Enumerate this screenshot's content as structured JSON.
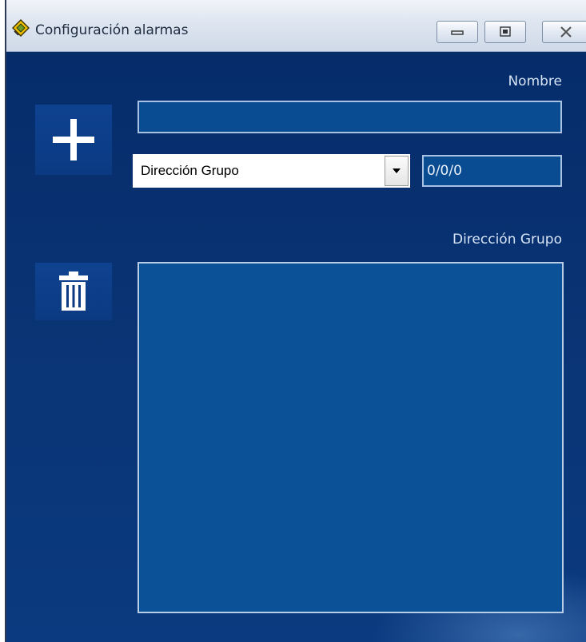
{
  "window": {
    "title": "Configuración alarmas",
    "app_icon": "knx-logo-icon",
    "caption_buttons": [
      "minimize-icon",
      "maximize-icon",
      "close-icon"
    ]
  },
  "form": {
    "nombre_label": "Nombre",
    "nombre_value": "",
    "address_type_selected": "Dirección Grupo",
    "address_value": "0/0/0",
    "list_label": "Dirección Grupo",
    "list_items": []
  },
  "actions": {
    "add_icon": "plus-icon",
    "delete_icon": "trash-icon"
  },
  "colors": {
    "background": "#0b3576",
    "field_fill": "#0a4c92",
    "field_border": "#a7c2e2",
    "label_text": "#d6e3f5"
  }
}
